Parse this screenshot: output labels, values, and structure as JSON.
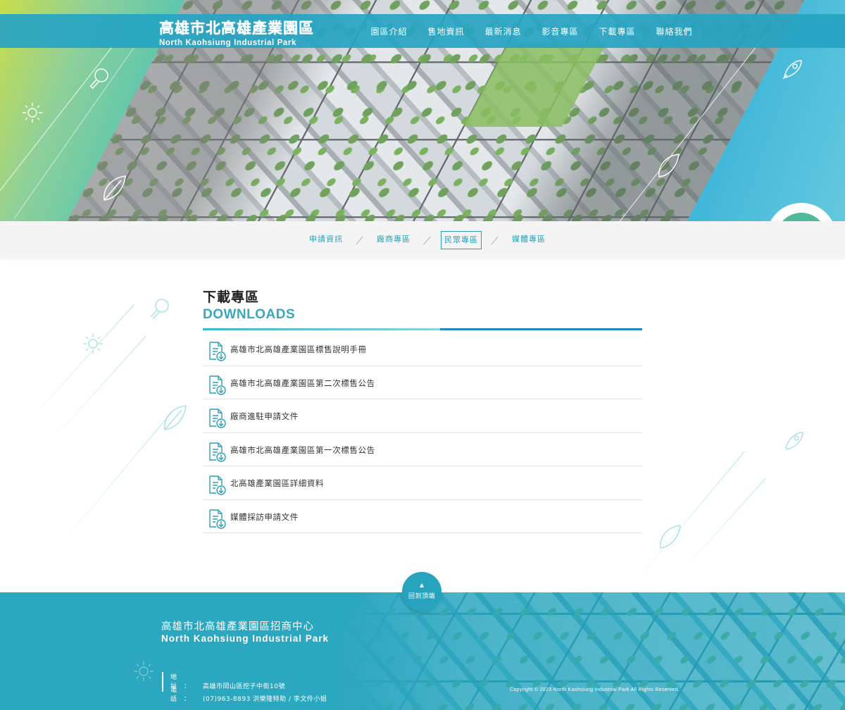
{
  "header": {
    "logo_zh": "高雄市北高雄產業園區",
    "logo_en": "North Kaohsiung Industrial Park",
    "nav": [
      {
        "label": "園區介紹"
      },
      {
        "label": "售地資訊"
      },
      {
        "label": "最新消息"
      },
      {
        "label": "影音專區"
      },
      {
        "label": "下載專區"
      },
      {
        "label": "聯絡我們"
      }
    ]
  },
  "subnav": {
    "items": [
      {
        "label": "申請資訊",
        "active": false
      },
      {
        "label": "廠商專區",
        "active": false
      },
      {
        "label": "民眾專區",
        "active": true
      },
      {
        "label": "媒體專區",
        "active": false
      }
    ]
  },
  "main": {
    "title_zh": "下載專區",
    "title_en": "DOWNLOADS",
    "downloads": [
      {
        "label": "高雄市北高雄產業園區標售說明手冊"
      },
      {
        "label": "高雄市北高雄產業園區第二次標售公告"
      },
      {
        "label": "廠商進駐申請文件"
      },
      {
        "label": "高雄市北高雄產業園區第一次標售公告"
      },
      {
        "label": "北高雄產業園區詳細資料"
      },
      {
        "label": "媒體採訪申請文件"
      }
    ]
  },
  "back_to_top": {
    "arrow": "▲",
    "label": "回到頂端"
  },
  "footer": {
    "name_zh": "高雄市北高雄產業園區招商中心",
    "name_en": "North Kaohsiung Industrial Park",
    "address_key": "地　址　：",
    "address": "高雄市岡山區挖子中街10號",
    "phone_key": "電　話　：",
    "phone": "(07)963-8893 洪榮隆特助 / 李文伶小姐",
    "copyright": "Copyright © 2023 North Kaohsiung Industrial Park  All Rights Reserved."
  },
  "colors": {
    "brand": "#27a3bd",
    "accent_title": "#35a8c0",
    "subnav_bg": "#f4f4f4"
  }
}
